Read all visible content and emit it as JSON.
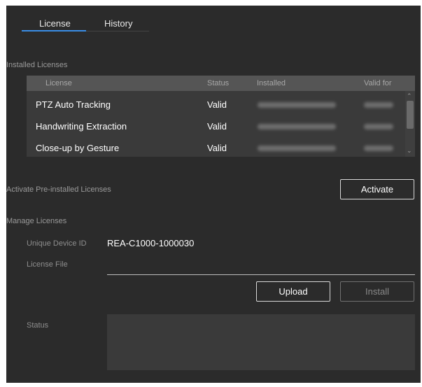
{
  "tabs": {
    "license": "License",
    "history": "History"
  },
  "installed": {
    "section_title": "Installed Licenses",
    "columns": {
      "license": "License",
      "status": "Status",
      "installed": "Installed",
      "valid_for": "Valid for"
    },
    "rows": [
      {
        "license": "PTZ Auto Tracking",
        "status": "Valid"
      },
      {
        "license": "Handwriting Extraction",
        "status": "Valid"
      },
      {
        "license": "Close-up by Gesture",
        "status": "Valid"
      }
    ]
  },
  "activate": {
    "section_title": "Activate Pre-installed Licenses",
    "button": "Activate"
  },
  "manage": {
    "section_title": "Manage Licenses",
    "device_id_label": "Unique Device ID",
    "device_id_value": "REA-C1000-1000030",
    "license_file_label": "License File",
    "upload_button": "Upload",
    "install_button": "Install",
    "status_label": "Status"
  },
  "colors": {
    "accent": "#3a8ee6",
    "panel_bg": "#2b2b2b",
    "table_header": "#555555"
  },
  "icons": {
    "scroll_up": "chevron-up-icon",
    "scroll_down": "chevron-down-icon"
  }
}
